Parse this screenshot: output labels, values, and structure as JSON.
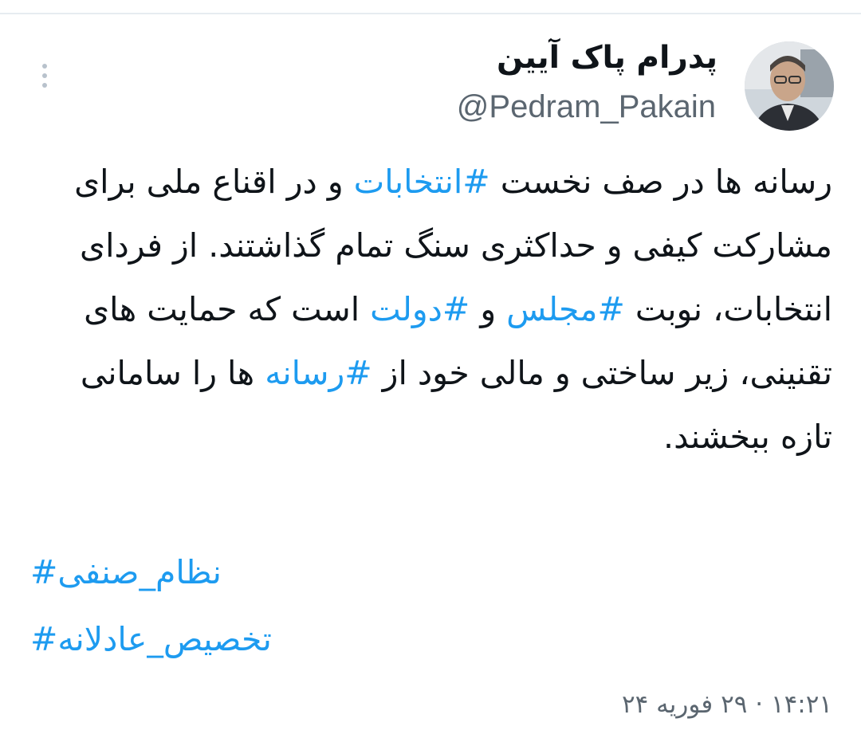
{
  "tweet": {
    "author": {
      "display_name": "پدرام پاک آیین",
      "handle": "@Pedram_Pakain"
    },
    "body": [
      {
        "text": "رسانه ها در صف نخست ",
        "tag": false
      },
      {
        "text": "#انتخابات",
        "tag": true
      },
      {
        "text": " و در اقناع ملی برای مشارکت کیفی و حداکثری سنگ تمام گذاشتند.",
        "tag": false
      },
      {
        "text": " از فردای انتخابات، نوبت ",
        "tag": false
      },
      {
        "text": "#مجلس",
        "tag": true
      },
      {
        "text": " و ",
        "tag": false
      },
      {
        "text": "#دولت",
        "tag": true
      },
      {
        "text": " است که حمایت های تقنینی، زیر ساختی و مالی خود از ",
        "tag": false
      },
      {
        "text": "#رسانه",
        "tag": true
      },
      {
        "text": " ها را سامانی تازه ببخشند.",
        "tag": false
      }
    ],
    "hashtags": [
      "نظام_صنفی#",
      "تخصیص_عادلانه#"
    ],
    "time": "۱۴:۲۱",
    "separator": "·",
    "date": "۲۹ فوریه ۲۴"
  },
  "colors": {
    "link": "#1d9bf0",
    "text": "#0f1419",
    "muted": "#5b6670"
  },
  "icons": {
    "menu": "more-vertical-icon"
  }
}
